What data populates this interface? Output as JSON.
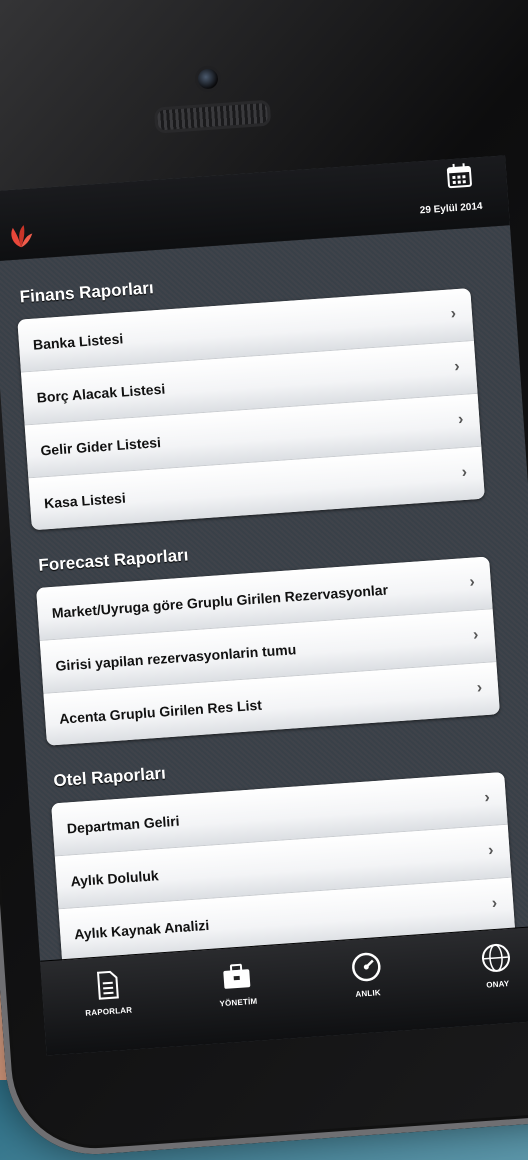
{
  "header": {
    "date": "29 Eylül 2014",
    "calendar_icon": "calendar-icon",
    "logo_icon": "flower-logo-icon"
  },
  "sections": [
    {
      "title": "Finans Raporları",
      "items": [
        "Banka Listesi",
        "Borç Alacak Listesi",
        "Gelir Gider Listesi",
        "Kasa Listesi"
      ]
    },
    {
      "title": "Forecast Raporları",
      "items": [
        "Market/Uyruga göre Gruplu Girilen Rezervasyonlar",
        "Girisi yapilan rezervasyonlarin tumu",
        "Acenta Gruplu Girilen Res List"
      ]
    },
    {
      "title": "Otel Raporları",
      "items": [
        "Departman Geliri",
        "Aylık Doluluk",
        "Aylık Kaynak Analizi",
        ""
      ]
    }
  ],
  "chevron": "›",
  "tabbar": {
    "tabs": [
      {
        "label": "RAPORLAR",
        "icon": "document-icon"
      },
      {
        "label": "YÖNETİM",
        "icon": "briefcase-icon"
      },
      {
        "label": "ANLIK",
        "icon": "gauge-icon"
      },
      {
        "label": "ONAY",
        "icon": "globe-icon"
      }
    ]
  },
  "colors": {
    "screen_bg": "#3c4047",
    "row_bg": "#ffffff",
    "accent": "#e8473a"
  }
}
